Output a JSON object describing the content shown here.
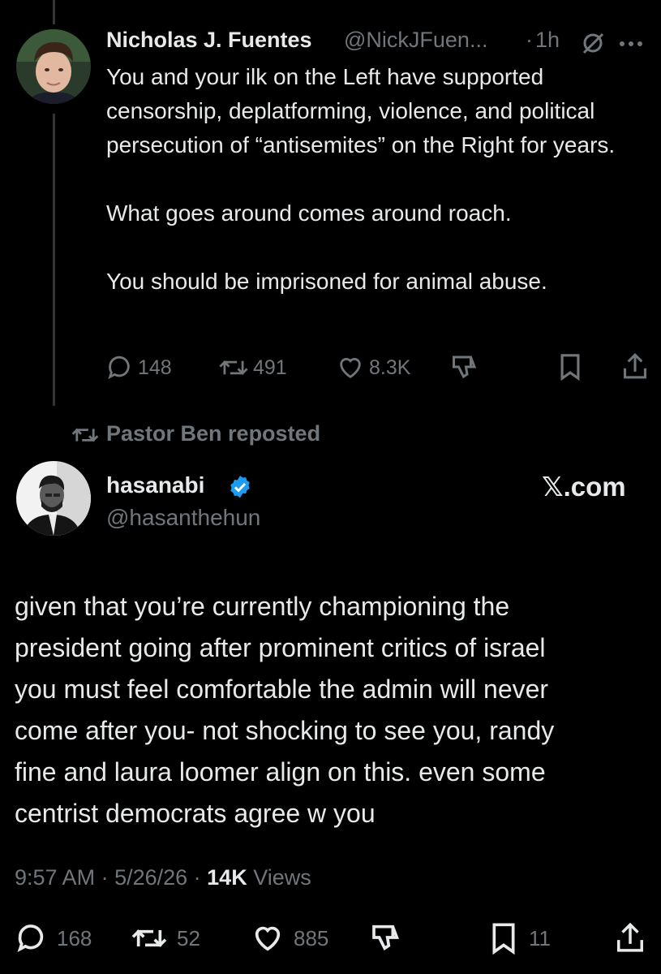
{
  "colors": {
    "background": "#000000",
    "text": "#e7e9ea",
    "muted": "#71767b",
    "verified": "#1d9bf0"
  },
  "post1": {
    "author_name": "Nicholas J. Fuentes",
    "handle": "@NickJFuen...",
    "separator": "·",
    "time": "1h",
    "grok_icon": "grok-icon",
    "more_icon": "more-icon",
    "paragraphs": [
      "You and your ilk on the Left have supported censorship, deplatforming, violence, and political persecution of “antisemites” on the Right for years.",
      "What goes around comes around roach.",
      "You should be imprisoned for animal abuse."
    ],
    "stats": {
      "replies": "148",
      "reposts": "491",
      "likes": "8.3K"
    }
  },
  "repost_banner": {
    "icon": "repost-icon",
    "text": "Pastor Ben reposted"
  },
  "post2": {
    "author_name": "hasanabi",
    "verified_icon": "verified-badge-icon",
    "handle": "@hasanthehun",
    "brand": "𝕏.com",
    "body_lines": [
      "given that you’re currently championing the",
      "president going after prominent critics of israel",
      "you must feel comfortable the admin will never",
      "come after you- not shocking to see you, randy",
      "fine and laura loomer align on this. even some",
      "centrist democrats agree w you"
    ],
    "meta": {
      "time": "9:57 AM",
      "date": "5/26/26",
      "views_count": "14K",
      "views_label": "Views",
      "separator": " · "
    },
    "stats": {
      "replies": "168",
      "reposts": "52",
      "likes": "885",
      "bookmarks": "11"
    }
  }
}
